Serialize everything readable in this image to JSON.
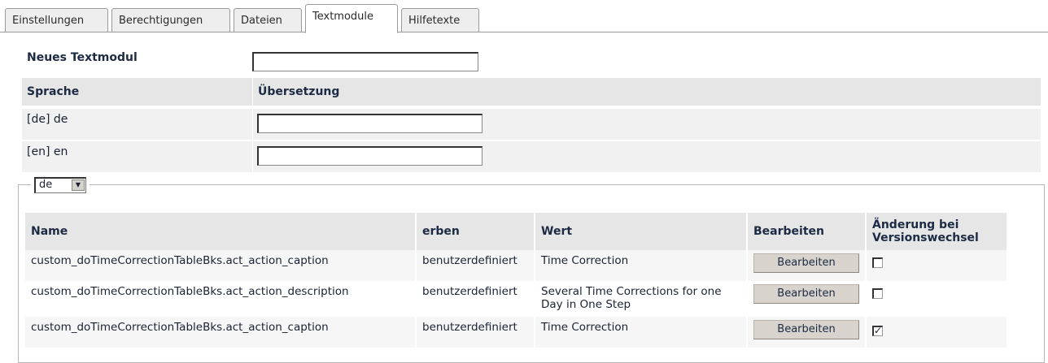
{
  "tabs": [
    "Einstellungen",
    "Berechtigungen",
    "Dateien",
    "Textmodule",
    "Hilfetexte"
  ],
  "active_tab": "Textmodule",
  "form": {
    "new_label": "Neues Textmodul",
    "new_value": "",
    "col_language": "Sprache",
    "col_translation": "Übersetzung",
    "languages": [
      {
        "label": "[de]  de",
        "value": ""
      },
      {
        "label": "[en]  en",
        "value": ""
      }
    ]
  },
  "language_select": {
    "value": "de"
  },
  "table": {
    "headers": {
      "name": "Name",
      "inherit": "erben",
      "value": "Wert",
      "edit": "Bearbeiten",
      "change": "Änderung bei Versionswechsel"
    },
    "rows": [
      {
        "name": "custom_doTimeCorrectionTableBks.act_action_caption",
        "inherit": "benutzerdefiniert",
        "value": "Time Correction",
        "button": "Bearbeiten",
        "checked": false
      },
      {
        "name": "custom_doTimeCorrectionTableBks.act_action_description",
        "inherit": "benutzerdefiniert",
        "value": "Several Time Corrections for one Day in One Step",
        "button": "Bearbeiten",
        "checked": false
      },
      {
        "name": "custom_doTimeCorrectionTableBks.act_action_caption",
        "inherit": "benutzerdefiniert",
        "value": "Time Correction",
        "button": "Bearbeiten",
        "checked": true
      }
    ]
  }
}
